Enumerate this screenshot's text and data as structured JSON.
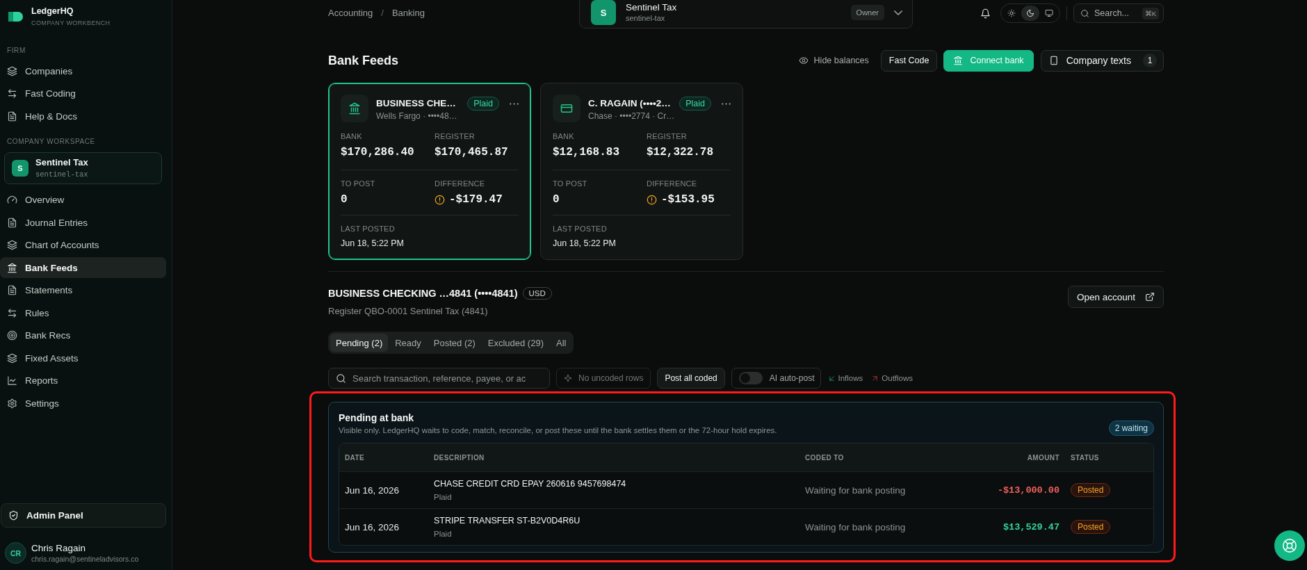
{
  "sidebar": {
    "brand": {
      "name": "LedgerHQ",
      "tagline": "COMPANY WORKBENCH"
    },
    "sections": [
      {
        "label": "FIRM",
        "items": [
          {
            "label": "Companies",
            "selected": false
          },
          {
            "label": "Fast Coding",
            "selected": false
          },
          {
            "label": "Help & Docs",
            "selected": false
          }
        ]
      },
      {
        "label": "COMPANY WORKSPACE",
        "company": {
          "initial": "S",
          "name": "Sentinel Tax",
          "slug": "sentinel-tax"
        },
        "items": [
          {
            "label": "Overview",
            "selected": false
          },
          {
            "label": "Journal Entries",
            "selected": false
          },
          {
            "label": "Chart of Accounts",
            "selected": false
          },
          {
            "label": "Bank Feeds",
            "selected": true
          },
          {
            "label": "Statements",
            "selected": false
          },
          {
            "label": "Rules",
            "selected": false
          },
          {
            "label": "Bank Recs",
            "selected": false
          },
          {
            "label": "Fixed Assets",
            "selected": false
          },
          {
            "label": "Reports",
            "selected": false
          },
          {
            "label": "Settings",
            "selected": false
          }
        ]
      }
    ],
    "admin_button": "Admin Panel",
    "user": {
      "initials": "CR",
      "name": "Chris Ragain",
      "email": "chris.ragain@sentineladvisors.co"
    }
  },
  "topbar": {
    "breadcrumb": {
      "items": [
        "Accounting",
        "Banking"
      ],
      "separator": "/"
    },
    "company_switcher": {
      "initial": "S",
      "name": "Sentinel Tax",
      "slug": "sentinel-tax",
      "role": "Owner"
    },
    "theme_options": [
      {
        "selected": false
      },
      {
        "selected": true
      },
      {
        "selected": false
      }
    ],
    "search": {
      "label": "Search...",
      "shortcut": "⌘K"
    }
  },
  "page_header": {
    "title": "Bank Feeds",
    "hide_balances": "Hide balances",
    "fast_code": "Fast Code",
    "connect_bank": "Connect bank",
    "company_texts": {
      "label": "Company texts",
      "count": "1"
    }
  },
  "accounts": [
    {
      "name": "BUSINESS CHE…",
      "meta": "Wells Fargo · ••••48…",
      "source": "Plaid",
      "selected": true,
      "bank_label": "BANK",
      "bank": "$170,286.40",
      "register_label": "REGISTER",
      "register": "$170,465.87",
      "to_post_label": "TO POST",
      "to_post": "0",
      "difference_label": "DIFFERENCE",
      "difference": "-$179.47",
      "warning": true,
      "last_posted_label": "LAST POSTED",
      "last_posted": "Jun 18, 5:22 PM"
    },
    {
      "name": "C. RAGAIN (••••2…",
      "meta": "Chase · ••••2774 · Cr…",
      "source": "Plaid",
      "selected": false,
      "bank_label": "BANK",
      "bank": "$12,168.83",
      "register_label": "REGISTER",
      "register": "$12,322.78",
      "to_post_label": "TO POST",
      "to_post": "0",
      "difference_label": "DIFFERENCE",
      "difference": "-$153.95",
      "warning": true,
      "last_posted_label": "LAST POSTED",
      "last_posted": "Jun 18, 5:22 PM"
    }
  ],
  "account_detail": {
    "title": "BUSINESS CHECKING …4841 (••••4841)",
    "currency": "USD",
    "subtitle": "Register QBO-0001 Sentinel Tax (4841)",
    "open_button": "Open account"
  },
  "tabs": [
    {
      "label": "Pending (2)",
      "selected": true
    },
    {
      "label": "Ready",
      "selected": false
    },
    {
      "label": "Posted (2)",
      "selected": false
    },
    {
      "label": "Excluded (29)",
      "selected": false
    },
    {
      "label": "All",
      "selected": false
    }
  ],
  "toolbar": {
    "search": {
      "placeholder": "Search transaction, reference, payee, or ac"
    },
    "uncoded": {
      "label": "No uncoded rows",
      "disabled": true
    },
    "post_all": "Post all coded",
    "auto_post": {
      "label": "AI auto-post",
      "on": false
    },
    "inflows": "Inflows",
    "outflows": "Outflows"
  },
  "pending": {
    "highlighted": true,
    "title": "Pending at bank",
    "description": "Visible only. LedgerHQ waits to code, match, reconcile, or post these until the bank settles them or the 72-hour hold expires.",
    "badge": "2 waiting",
    "columns": [
      "DATE",
      "DESCRIPTION",
      "CODED TO",
      "AMOUNT",
      "STATUS"
    ],
    "rows": [
      {
        "date": "Jun 16, 2026",
        "description": "CHASE CREDIT CRD EPAY 260616 9457698474",
        "source": "Plaid",
        "coded_to": "Waiting for bank posting",
        "amount": "-$13,000.00",
        "kind": "outflow",
        "status": "Posted"
      },
      {
        "date": "Jun 16, 2026",
        "description": "STRIPE TRANSFER ST-B2V0D4R6U",
        "source": "Plaid",
        "coded_to": "Waiting for bank posting",
        "amount": "$13,529.47",
        "kind": "inflow",
        "status": "Posted"
      }
    ]
  }
}
